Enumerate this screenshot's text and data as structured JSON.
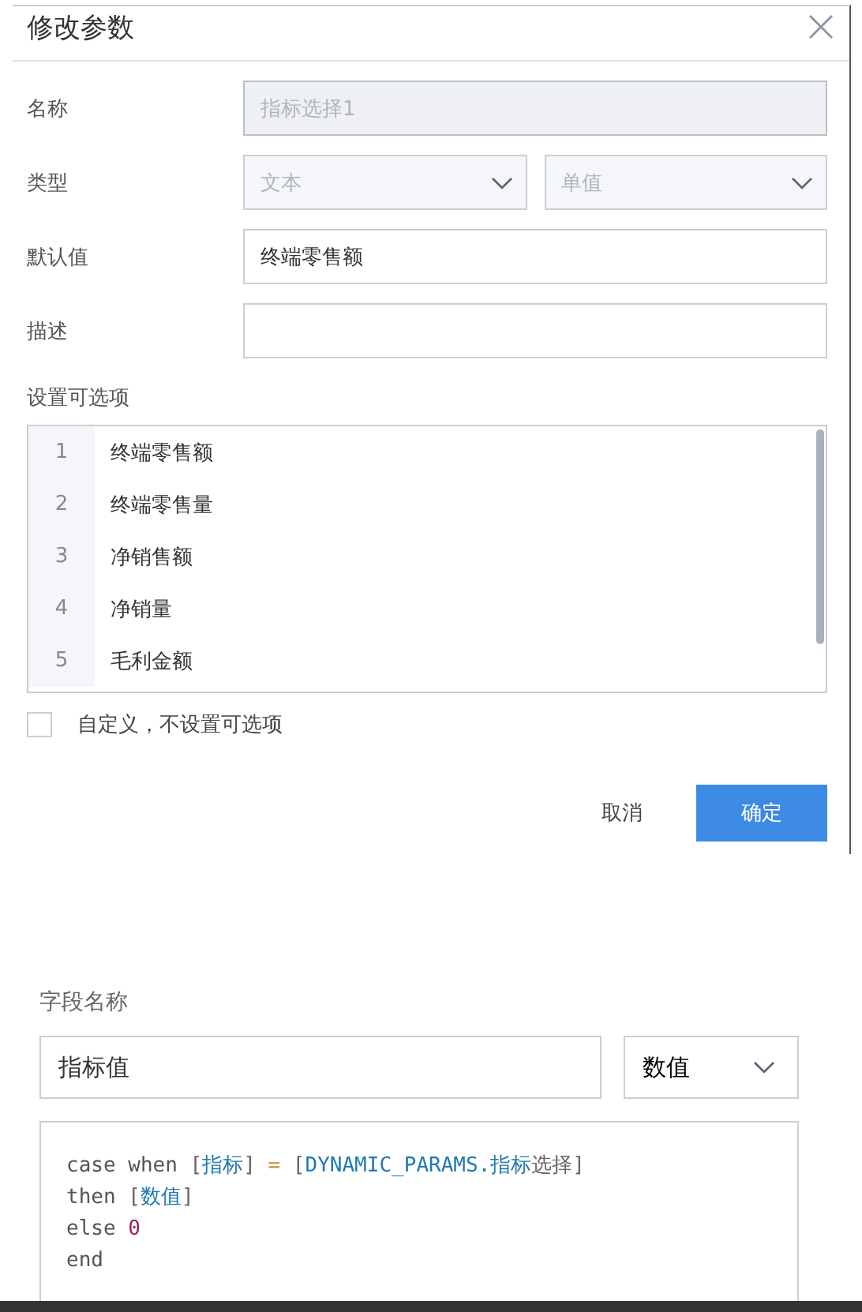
{
  "dialog": {
    "title": "修改参数",
    "fields": [
      {
        "label": "名称",
        "kind": "input",
        "value": "指标选择1",
        "disabled": true
      },
      {
        "label": "类型",
        "kind": "selects",
        "selects": [
          {
            "value": "文本",
            "disabled": true
          },
          {
            "value": "单值",
            "disabled": true
          }
        ]
      },
      {
        "label": "默认值",
        "kind": "input",
        "value": "终端零售额",
        "disabled": false
      },
      {
        "label": "描述",
        "kind": "input",
        "disabled": false
      }
    ],
    "options_label": "设置可选项",
    "options": [
      {
        "number": "1",
        "text": "终端零售额"
      },
      {
        "number": "2",
        "text": "终端零售量"
      },
      {
        "number": "3",
        "text": "净销售额"
      },
      {
        "number": "4",
        "text": "净销量"
      },
      {
        "number": "5",
        "text": "毛利金额"
      }
    ],
    "custom_checkbox": {
      "label": "自定义，不设置可选项",
      "checked": false
    },
    "buttons": [
      {
        "label": "取消",
        "kind": "secondary"
      },
      {
        "label": "确定",
        "kind": "primary"
      }
    ]
  },
  "field_editor": {
    "label": "字段名称",
    "name_value": "指标值",
    "type_value": "数值",
    "code": [
      [
        {
          "text": "case when ",
          "kind": "keyword"
        },
        {
          "text": "[",
          "kind": "bracket"
        },
        {
          "text": "指标",
          "kind": "field"
        },
        {
          "text": "] ",
          "kind": "bracket"
        },
        {
          "text": "= ",
          "kind": "operator"
        },
        {
          "text": "[",
          "kind": "bracket"
        },
        {
          "text": "DYNAMIC_PARAMS.指标",
          "kind": "field"
        },
        {
          "text": "选择]",
          "kind": "bracket"
        }
      ],
      [
        {
          "text": "then ",
          "kind": "keyword"
        },
        {
          "text": "[",
          "kind": "bracket"
        },
        {
          "text": "数值",
          "kind": "field"
        },
        {
          "text": "]",
          "kind": "bracket"
        }
      ],
      [
        {
          "text": "else ",
          "kind": "keyword"
        },
        {
          "text": "0",
          "kind": "number"
        }
      ],
      [
        {
          "text": "end",
          "kind": "keyword"
        }
      ]
    ]
  }
}
